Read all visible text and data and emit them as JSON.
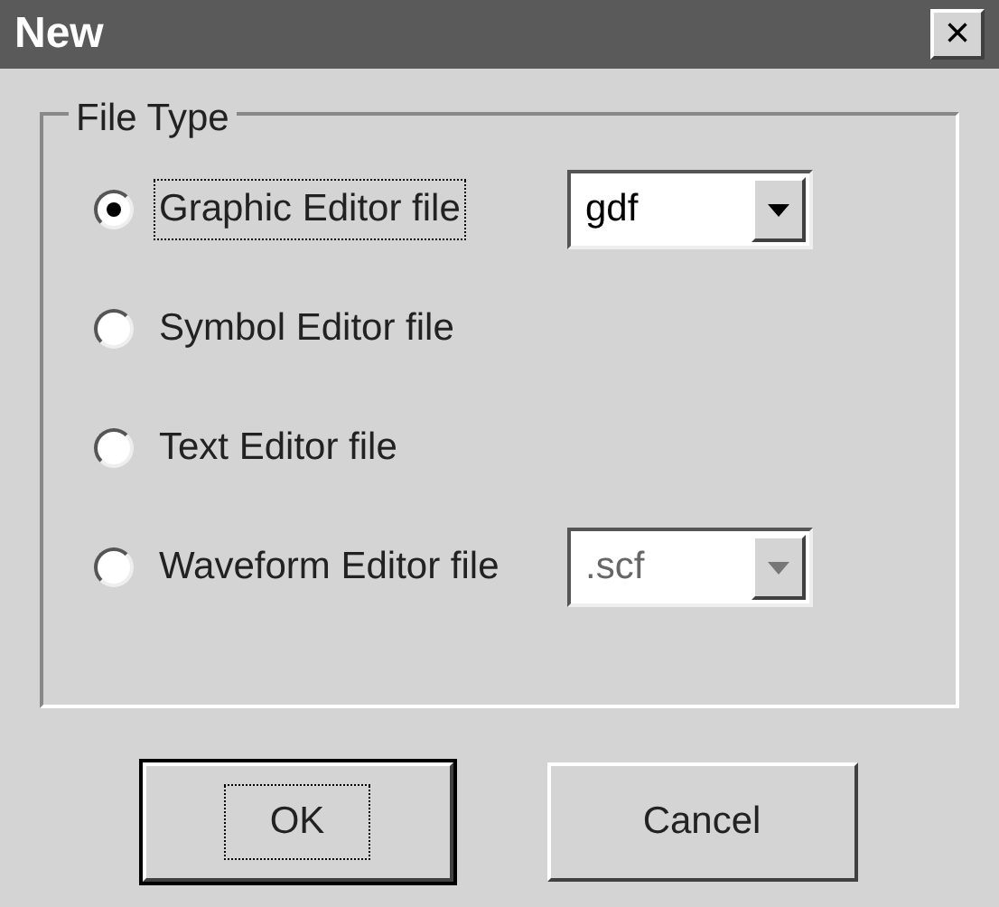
{
  "window": {
    "title": "New",
    "close": "×"
  },
  "group": {
    "title": "File Type",
    "options": [
      {
        "label": "Graphic Editor file",
        "selected": true,
        "combo": {
          "value": "gdf",
          "disabled": false
        }
      },
      {
        "label": "Symbol Editor file",
        "selected": false
      },
      {
        "label": "Text Editor file",
        "selected": false
      },
      {
        "label": "Waveform Editor file",
        "selected": false,
        "combo": {
          "value": ".scf",
          "disabled": true
        }
      }
    ]
  },
  "buttons": [
    {
      "label": "OK",
      "focused": true
    },
    {
      "label": "Cancel",
      "focused": false
    }
  ]
}
